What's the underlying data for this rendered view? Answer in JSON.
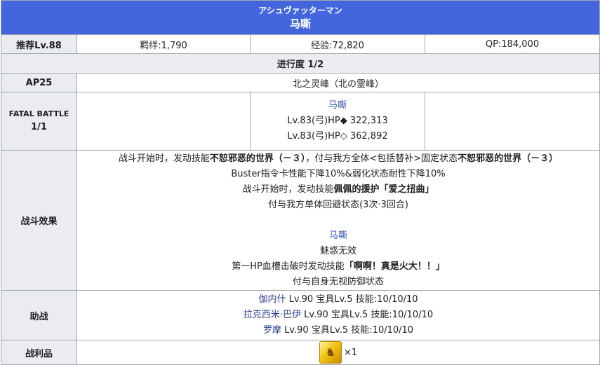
{
  "header": {
    "jp_title": "アシュヴァッターマン",
    "cn_title": "马嘶"
  },
  "rewards": {
    "recommended_label": "推荐Lv.88",
    "bond": "羁绊:1,790",
    "exp": "经验:72,820",
    "qp": "QP:184,000"
  },
  "progress_label": "进行度 1/2",
  "ap": {
    "label": "AP25",
    "location": "北之灵峰（北の霊峰）"
  },
  "battle": {
    "label_line1": "FATAL BATTLE",
    "label_line2": "1/1",
    "enemy_name": "马嘶",
    "hp_line1": "Lv.83(弓)HP◆ 322,313",
    "hp_line2": "Lv.83(弓)HP◇ 362,892"
  },
  "effects": {
    "label": "战斗效果",
    "l1_a": "战斗开始时，发动技能",
    "l1_b": "不恕邪恶的世界（－３）",
    "l1_c": "，付与我方全体<包括替补>固定状态",
    "l1_d": "不恕邪恶的世界（－３）",
    "l2": "Buster指令卡性能下降10%&弱化状态耐性下降10%",
    "l3_a": "战斗开始时，发动技能",
    "l3_b": "佩佩的援护「爱之扭曲」",
    "l4": "付与我方单体回避状态(3次·3回合)",
    "enemy_name": "马嘶",
    "l5": "魅惑无效",
    "l6_a": "第一HP血槽击破时发动技能",
    "l6_b": "「啊啊！真是火大！！」",
    "l7": "付与自身无视防御状态"
  },
  "support": {
    "label": "助战",
    "rows": [
      {
        "name": "伽内什",
        "detail": " Lv.90 宝具Lv.5 技能:10/10/10"
      },
      {
        "name": "拉克西米·巴伊",
        "detail": " Lv.90 宝具Lv.5 技能:10/10/10"
      },
      {
        "name": "罗摩",
        "detail": " Lv.90 宝具Lv.5 技能:10/10/10"
      }
    ]
  },
  "loot": {
    "label": "战利品",
    "icon": "gold-item-icon",
    "qty": "×1"
  }
}
